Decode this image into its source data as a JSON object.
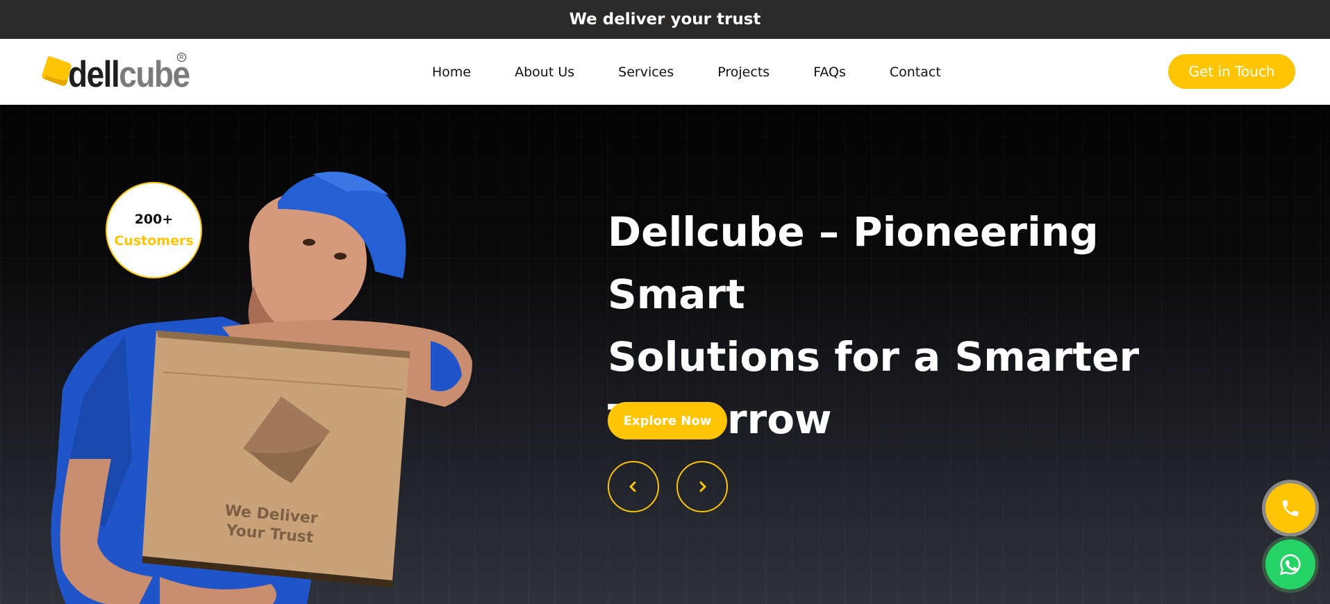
{
  "topbar": {
    "text": "We deliver your trust"
  },
  "header": {
    "logo": {
      "part1": "dell",
      "part2": "cube",
      "registered": "R"
    },
    "nav": [
      "Home",
      "About Us",
      "Services",
      "Projects",
      "FAQs",
      "Contact"
    ],
    "cta": "Get in Touch"
  },
  "hero": {
    "badge": {
      "number": "200+",
      "label": "Customers"
    },
    "headline_lines": [
      "Dellcube – Pioneering Smart",
      "Solutions for a Smarter",
      "Tomorrow"
    ],
    "box_text_lines": [
      "We Deliver",
      "Your Trust"
    ],
    "explore": "Explore Now",
    "prev_icon": "chevron-left-icon",
    "next_icon": "chevron-right-icon"
  },
  "floating": {
    "phone_icon": "phone-icon",
    "whatsapp_icon": "whatsapp-icon"
  },
  "colors": {
    "accent": "#fdc506",
    "topbar": "#2b2a28",
    "whatsapp": "#25d366",
    "shirt": "#1f55c9"
  }
}
